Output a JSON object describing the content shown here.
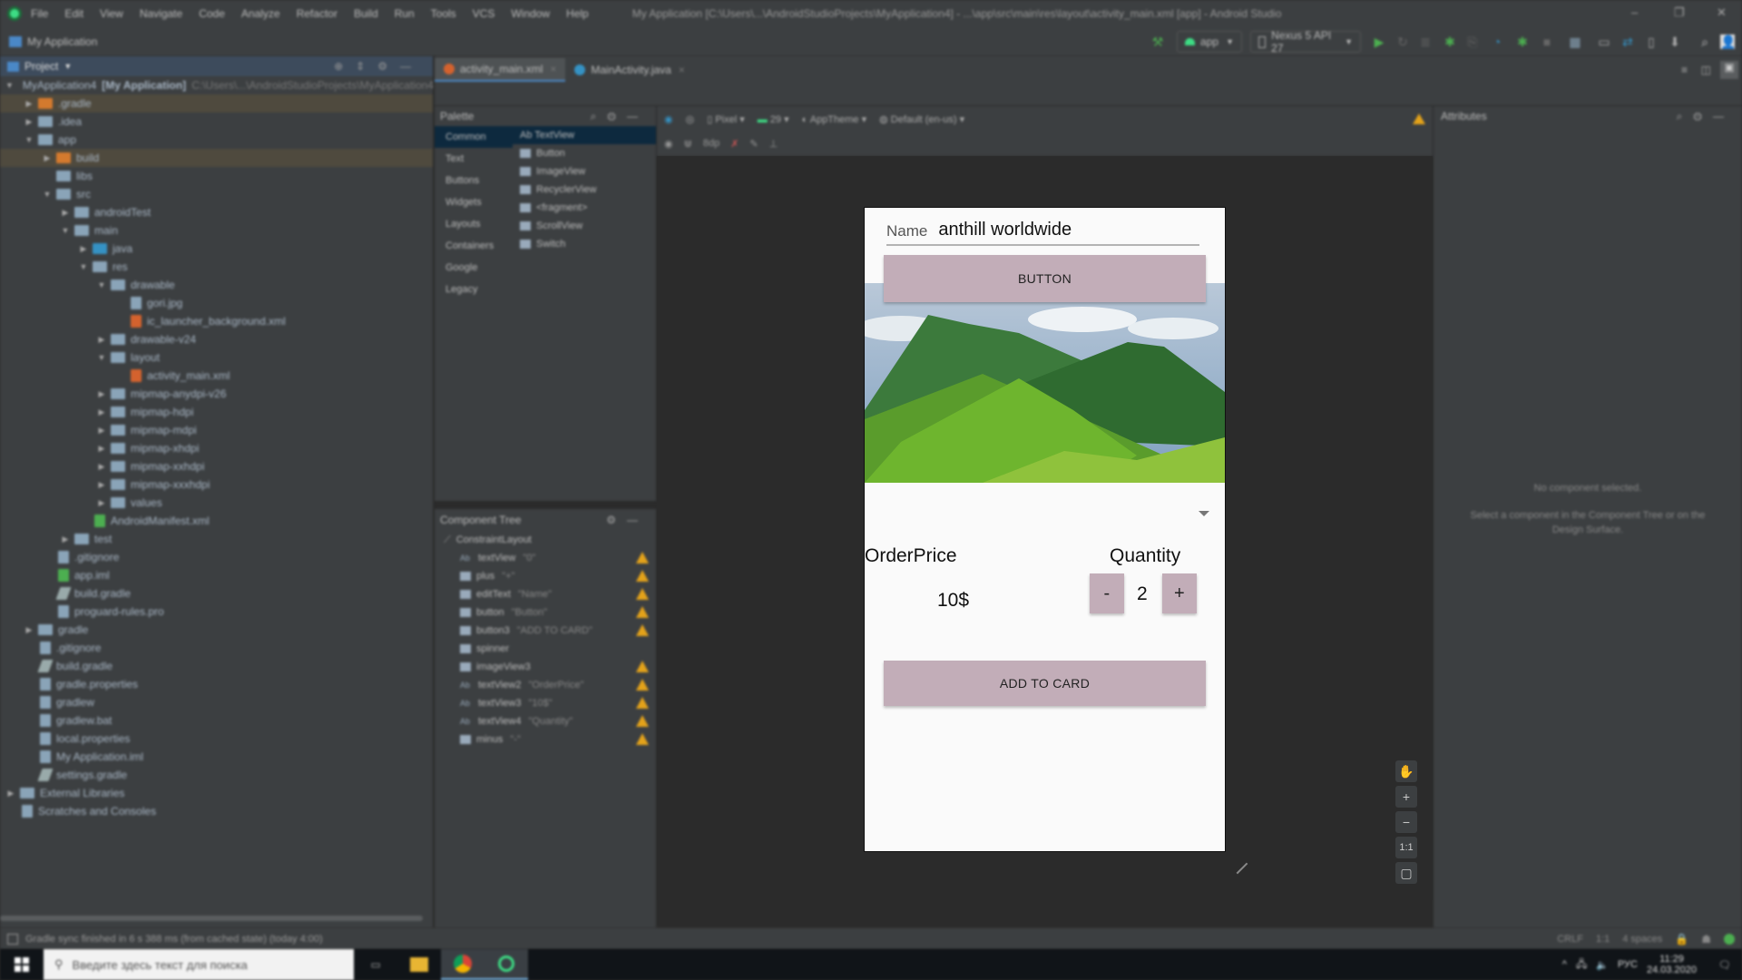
{
  "window": {
    "title": "My Application [C:\\Users\\...\\AndroidStudioProjects\\MyApplication4] - ...\\app\\src\\main\\res\\layout\\activity_main.xml [app] - Android Studio",
    "menu": [
      "File",
      "Edit",
      "View",
      "Navigate",
      "Code",
      "Analyze",
      "Refactor",
      "Build",
      "Run",
      "Tools",
      "VCS",
      "Window",
      "Help"
    ],
    "controls": {
      "minimize": "–",
      "restore": "❐",
      "close": "✕"
    }
  },
  "navbar": {
    "project_name": "My Application",
    "run_config": "app",
    "device": "Nexus 5 API 27"
  },
  "project_panel": {
    "header": "Project",
    "tree": [
      {
        "depth": 0,
        "arrow": "down",
        "icon": "project-folder",
        "label": "MyApplication4",
        "suffix": "[My Application]",
        "path": "C:\\Users\\...\\AndroidStudioProjects\\MyApplication4",
        "highlight": false
      },
      {
        "depth": 1,
        "arrow": "right",
        "icon": "folder-orange",
        "label": ".gradle",
        "highlight": true
      },
      {
        "depth": 1,
        "arrow": "right",
        "icon": "folder",
        "label": ".idea",
        "highlight": false
      },
      {
        "depth": 1,
        "arrow": "down",
        "icon": "folder",
        "label": "app",
        "highlight": false
      },
      {
        "depth": 2,
        "arrow": "right",
        "icon": "folder-orange",
        "label": "build",
        "highlight": true
      },
      {
        "depth": 2,
        "arrow": "",
        "icon": "folder",
        "label": "libs",
        "highlight": false
      },
      {
        "depth": 2,
        "arrow": "down",
        "icon": "folder",
        "label": "src",
        "highlight": false
      },
      {
        "depth": 3,
        "arrow": "right",
        "icon": "folder",
        "label": "androidTest",
        "highlight": false
      },
      {
        "depth": 3,
        "arrow": "down",
        "icon": "folder",
        "label": "main",
        "highlight": false
      },
      {
        "depth": 4,
        "arrow": "right",
        "icon": "folder-blue",
        "label": "java",
        "highlight": false
      },
      {
        "depth": 4,
        "arrow": "down",
        "icon": "folder",
        "label": "res",
        "highlight": false
      },
      {
        "depth": 5,
        "arrow": "down",
        "icon": "folder",
        "label": "drawable",
        "highlight": false
      },
      {
        "depth": 6,
        "arrow": "",
        "icon": "file",
        "label": "gori.jpg",
        "highlight": false
      },
      {
        "depth": 6,
        "arrow": "",
        "icon": "file-xml",
        "label": "ic_launcher_background.xml",
        "highlight": false
      },
      {
        "depth": 5,
        "arrow": "right",
        "icon": "folder",
        "label": "drawable-v24",
        "highlight": false
      },
      {
        "depth": 5,
        "arrow": "down",
        "icon": "folder",
        "label": "layout",
        "highlight": false
      },
      {
        "depth": 6,
        "arrow": "",
        "icon": "file-xml",
        "label": "activity_main.xml",
        "highlight": false
      },
      {
        "depth": 5,
        "arrow": "right",
        "icon": "folder",
        "label": "mipmap-anydpi-v26",
        "highlight": false
      },
      {
        "depth": 5,
        "arrow": "right",
        "icon": "folder",
        "label": "mipmap-hdpi",
        "highlight": false
      },
      {
        "depth": 5,
        "arrow": "right",
        "icon": "folder",
        "label": "mipmap-mdpi",
        "highlight": false
      },
      {
        "depth": 5,
        "arrow": "right",
        "icon": "folder",
        "label": "mipmap-xhdpi",
        "highlight": false
      },
      {
        "depth": 5,
        "arrow": "right",
        "icon": "folder",
        "label": "mipmap-xxhdpi",
        "highlight": false
      },
      {
        "depth": 5,
        "arrow": "right",
        "icon": "folder",
        "label": "mipmap-xxxhdpi",
        "highlight": false
      },
      {
        "depth": 5,
        "arrow": "right",
        "icon": "folder",
        "label": "values",
        "highlight": false
      },
      {
        "depth": 4,
        "arrow": "",
        "icon": "file-green",
        "label": "AndroidManifest.xml",
        "highlight": false
      },
      {
        "depth": 3,
        "arrow": "right",
        "icon": "folder",
        "label": "test",
        "highlight": false
      },
      {
        "depth": 2,
        "arrow": "",
        "icon": "file",
        "label": ".gitignore",
        "highlight": false
      },
      {
        "depth": 2,
        "arrow": "",
        "icon": "file-green",
        "label": "app.iml",
        "highlight": false
      },
      {
        "depth": 2,
        "arrow": "",
        "icon": "file-gradle",
        "label": "build.gradle",
        "highlight": false
      },
      {
        "depth": 2,
        "arrow": "",
        "icon": "file",
        "label": "proguard-rules.pro",
        "highlight": false
      },
      {
        "depth": 1,
        "arrow": "right",
        "icon": "folder",
        "label": "gradle",
        "highlight": false
      },
      {
        "depth": 1,
        "arrow": "",
        "icon": "file",
        "label": ".gitignore",
        "highlight": false
      },
      {
        "depth": 1,
        "arrow": "",
        "icon": "file-gradle",
        "label": "build.gradle",
        "highlight": false
      },
      {
        "depth": 1,
        "arrow": "",
        "icon": "file",
        "label": "gradle.properties",
        "highlight": false
      },
      {
        "depth": 1,
        "arrow": "",
        "icon": "file",
        "label": "gradlew",
        "highlight": false
      },
      {
        "depth": 1,
        "arrow": "",
        "icon": "file",
        "label": "gradlew.bat",
        "highlight": false
      },
      {
        "depth": 1,
        "arrow": "",
        "icon": "file",
        "label": "local.properties",
        "highlight": false
      },
      {
        "depth": 1,
        "arrow": "",
        "icon": "file-blue",
        "label": "My Application.iml",
        "highlight": false
      },
      {
        "depth": 1,
        "arrow": "",
        "icon": "file-gradle",
        "label": "settings.gradle",
        "highlight": false
      },
      {
        "depth": 0,
        "arrow": "right",
        "icon": "library",
        "label": "External Libraries",
        "highlight": false
      },
      {
        "depth": 0,
        "arrow": "",
        "icon": "scratches",
        "label": "Scratches and Consoles",
        "highlight": false
      }
    ]
  },
  "editor_tabs": [
    {
      "label": "activity_main.xml",
      "active": true
    },
    {
      "label": "MainActivity.java",
      "active": false
    }
  ],
  "palette": {
    "title": "Palette",
    "categories": [
      "Common",
      "Text",
      "Buttons",
      "Widgets",
      "Layouts",
      "Containers",
      "Google",
      "Legacy"
    ],
    "items": [
      "Ab TextView",
      "Button",
      "ImageView",
      "RecyclerView",
      "<fragment>",
      "ScrollView",
      "Switch"
    ]
  },
  "design_toolbar": {
    "device": "Pixel",
    "api": "29",
    "theme": "AppTheme",
    "locale": "Default (en-us)",
    "margin": "8dp"
  },
  "component_tree": {
    "title": "Component Tree",
    "root": "ConstraintLayout",
    "items": [
      {
        "icon": "Ab",
        "id": "textView",
        "text": "\"0\"",
        "warn": true
      },
      {
        "icon": "btn",
        "id": "plus",
        "text": "\"+\"",
        "warn": true
      },
      {
        "icon": "edit",
        "id": "editText",
        "text": "\"Name\"",
        "warn": true
      },
      {
        "icon": "btn",
        "id": "button",
        "text": "\"Button\"",
        "warn": true
      },
      {
        "icon": "btn",
        "id": "button3",
        "text": "\"ADD TO CARD\"",
        "warn": true
      },
      {
        "icon": "spin",
        "id": "spinner",
        "text": "",
        "warn": false
      },
      {
        "icon": "img",
        "id": "imageView3",
        "text": "",
        "warn": true
      },
      {
        "icon": "Ab",
        "id": "textView2",
        "text": "\"OrderPrice\"",
        "warn": true
      },
      {
        "icon": "Ab",
        "id": "textView3",
        "text": "\"10$\"",
        "warn": true
      },
      {
        "icon": "Ab",
        "id": "textView4",
        "text": "\"Quantity\"",
        "warn": true
      },
      {
        "icon": "btn",
        "id": "minus",
        "text": "\"-\"",
        "warn": true
      }
    ]
  },
  "phone": {
    "name_label": "Name",
    "name_value": "anthill worldwide",
    "button_label": "BUTTON",
    "order_price_label": "OrderPrice",
    "price_value": "10$",
    "quantity_label": "Quantity",
    "minus_label": "-",
    "quantity_value": "2",
    "plus_label": "+",
    "add_to_card_label": "ADD TO CARD",
    "button_color": "#c2adb8"
  },
  "attributes": {
    "title": "Attributes",
    "empty_title": "No component selected.",
    "empty_hint": "Select a component in the Component Tree or on the Design Surface."
  },
  "zoom_controls": {
    "pan": "✋",
    "zoom_in": "+",
    "zoom_out": "−",
    "actual": "1:1",
    "fit": "▢"
  },
  "statusbar": {
    "message": "Gradle sync finished in 6 s 388 ms (from cached state) (today 4:00)",
    "line_sep": "CRLF",
    "position": "1:1",
    "indent": "4 spaces"
  },
  "taskbar": {
    "search_placeholder": "Введите здесь текст для поиска",
    "lang": "РУС",
    "time": "11:29",
    "date": "24.03.2020"
  }
}
